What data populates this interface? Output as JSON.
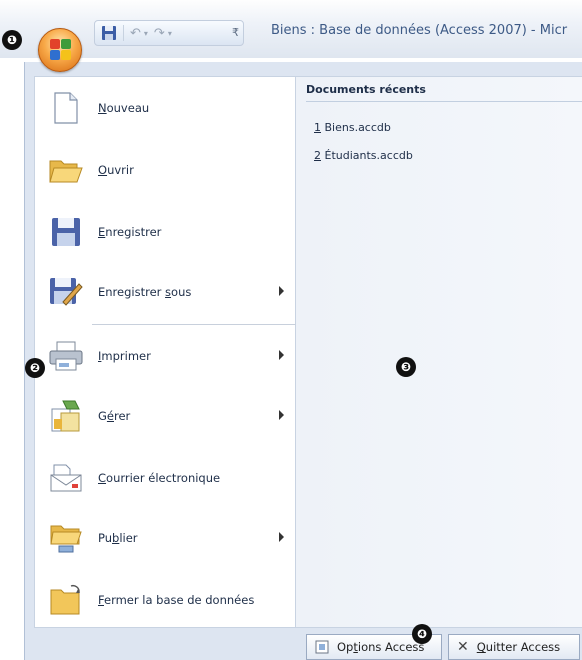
{
  "title_bar": {
    "title": "Biens : Base de données (Access 2007) - Micr",
    "quick_access": [
      "save-icon",
      "undo-icon",
      "redo-icon",
      "customize-icon"
    ]
  },
  "menu": {
    "items": [
      {
        "label": "Nouveau",
        "mnemonic": "N",
        "rest": "ouveau",
        "icon": "new-document-icon",
        "submenu": false
      },
      {
        "label": "Ouvrir",
        "mnemonic": "O",
        "rest": "uvrir",
        "icon": "open-folder-icon",
        "submenu": false
      },
      {
        "label": "Enregistrer",
        "mnemonic": "E",
        "rest": "nregistrer",
        "icon": "save-icon",
        "submenu": false
      },
      {
        "label": "Enregistrer sous",
        "mnemonic": "",
        "rest": "",
        "icon": "save-as-icon",
        "submenu": true
      },
      {
        "label": "Imprimer",
        "mnemonic": "I",
        "rest": "mprimer",
        "icon": "printer-icon",
        "submenu": true
      },
      {
        "label": "Gérer",
        "mnemonic": "",
        "rest": "",
        "icon": "manage-icon",
        "submenu": true
      },
      {
        "label": "Courrier électronique",
        "mnemonic": "C",
        "rest": "ourrier électronique",
        "icon": "email-icon",
        "submenu": false
      },
      {
        "label": "Publier",
        "mnemonic": "",
        "rest": "",
        "icon": "publish-icon",
        "submenu": true
      },
      {
        "label": "Fermer la base de données",
        "mnemonic": "F",
        "rest": "ermer la base de données",
        "icon": "close-database-icon",
        "submenu": false
      }
    ],
    "save_as_parts": [
      "Enregistrer ",
      "s",
      "ous"
    ],
    "manage_parts": [
      "G",
      "é",
      "rer"
    ],
    "publish_parts": [
      "Pu",
      "b",
      "lier"
    ]
  },
  "recent": {
    "header": "Documents récents",
    "items": [
      {
        "num": "1",
        "name": "Biens.accdb"
      },
      {
        "num": "2",
        "name": "Étudiants.accdb"
      }
    ]
  },
  "buttons": {
    "options_parts": [
      "Op",
      "t",
      "ions Access"
    ],
    "quit_parts": [
      "Q",
      "u",
      "itter Access"
    ],
    "options_label": "Options Access",
    "quit_label": "Quitter Access"
  },
  "callouts": [
    "❶",
    "❷",
    "❸",
    "❹"
  ]
}
